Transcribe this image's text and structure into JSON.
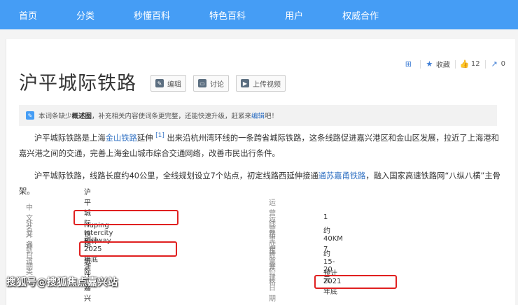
{
  "nav": {
    "items": [
      "首页",
      "分类",
      "秒懂百科",
      "特色百科",
      "用户",
      "权威合作"
    ]
  },
  "article": {
    "title": "沪平城际铁路",
    "buttons": {
      "edit": "编辑",
      "discuss": "讨论",
      "upload_video": "上传视频"
    },
    "tools": {
      "collect": "收藏",
      "like_count": "12",
      "share_count": "0"
    },
    "notice": {
      "prefix": "本词条缺少",
      "bold": "概述图",
      "middle": "，补充相关内容使词条更完整，还能快速升级，赶紧来",
      "link": "编辑",
      "suffix": "吧！"
    },
    "para1": {
      "t1": "沪平城际铁路是上海",
      "link1": "金山铁路",
      "t2": "延伸",
      "sup": "[1]",
      "t3": "出来沿杭州湾环线的一条跨省城际铁路，这条线路促进嘉兴港区和金山区发展，拉近了上海港和嘉兴港之间的交通，完善上海金山城市综合交通网络，改善市民出行条件。"
    },
    "para2": {
      "t1": "沪平城际铁路，线路长度约40公里，全线规划设立7个站点，初定线路西延伸接通",
      "link1": "通苏嘉甬铁路",
      "t2": "，融入国家高速铁路网“八纵八横”主骨架。"
    },
    "infobox": {
      "left": [
        {
          "label": "中文名",
          "value": "沪平城际铁路"
        },
        {
          "label": "外文名",
          "value": "Huping Intercity Railway"
        },
        {
          "label": "开通日期",
          "value": "预计2025年底"
        },
        {
          "label": "轨道类型",
          "value": "城际"
        },
        {
          "label": "",
          "value": "浙江嘉兴"
        }
      ],
      "right": [
        {
          "label": "运营线路",
          "value": "1"
        },
        {
          "label": "运营里程",
          "value": "约40KM"
        },
        {
          "label": "车站数量",
          "value": "7"
        },
        {
          "label": "车票价格",
          "value": "约15-20元"
        },
        {
          "label": "开建日期",
          "value": "预计2021年底"
        }
      ]
    }
  },
  "watermark": "搜狐号@搜狐焦点嘉兴站",
  "colors": {
    "nav_bg": "#459df5",
    "link": "#2e6fc2",
    "highlight": "#e02020"
  }
}
